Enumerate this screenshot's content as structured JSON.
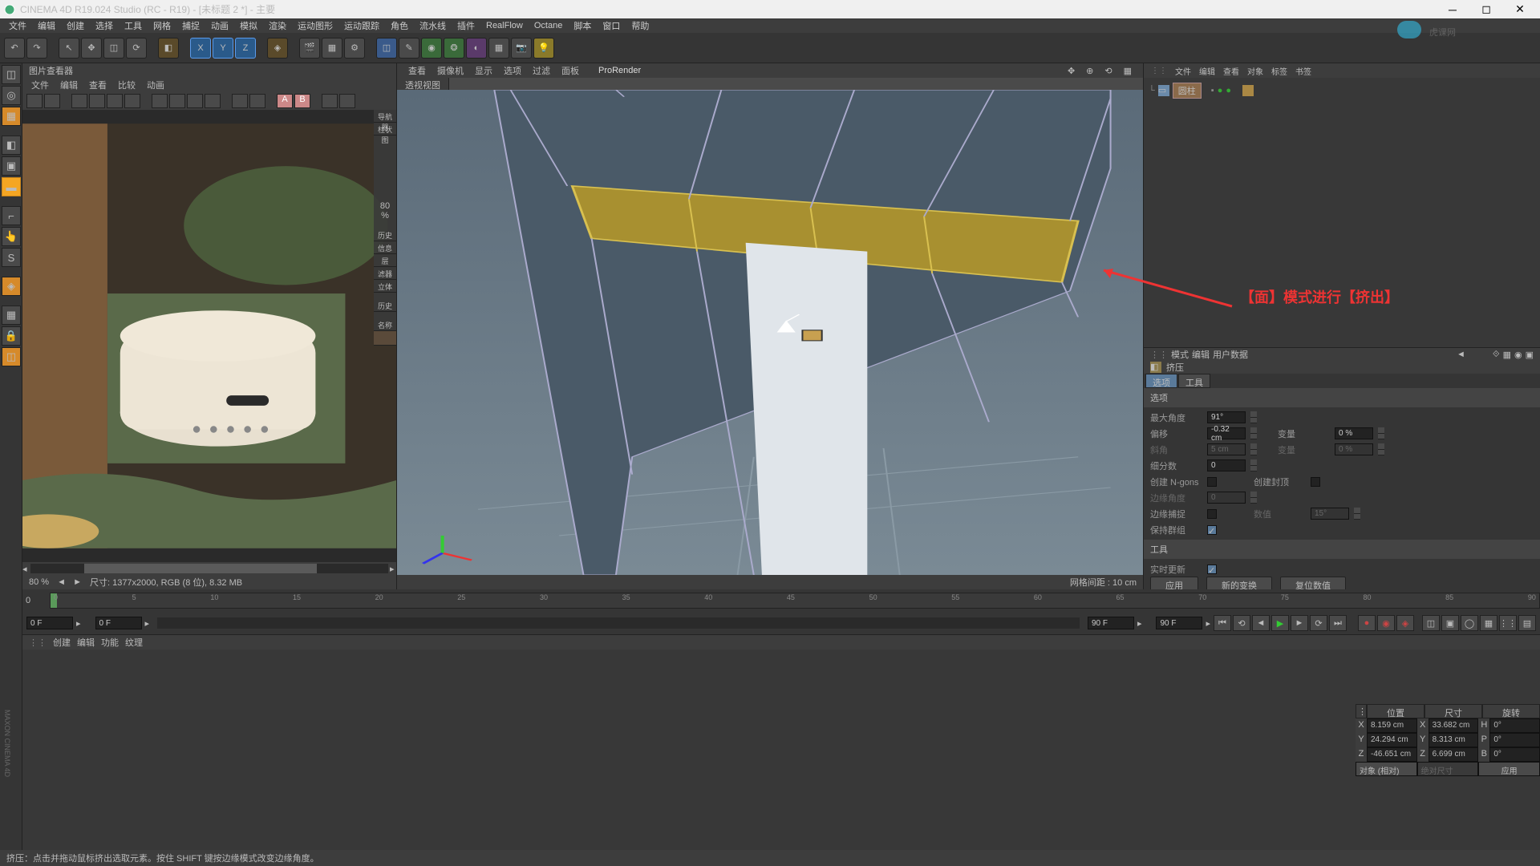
{
  "title": "CINEMA 4D R19.024 Studio (RC - R19) - [未标题 2 *] - 主要",
  "menu": [
    "文件",
    "编辑",
    "创建",
    "选择",
    "工具",
    "网格",
    "捕捉",
    "动画",
    "模拟",
    "渲染",
    "运动图形",
    "运动跟踪",
    "角色",
    "流水线",
    "插件",
    "RealFlow",
    "Octane",
    "脚本",
    "窗口",
    "帮助"
  ],
  "imgpanel": {
    "title": "图片查看器",
    "menu": [
      "文件",
      "编辑",
      "查看",
      "比较",
      "动画"
    ]
  },
  "imgstatus": {
    "zoom": "80 %",
    "info": "尺寸: 1377x2000, RGB (8 位), 8.32 MB"
  },
  "viewport": {
    "menu": [
      "查看",
      "摄像机",
      "显示",
      "选项",
      "过滤",
      "面板",
      "ProRender"
    ],
    "tab": "透视视图",
    "footer": "网格间距 : 10 cm",
    "zoom": "80 %"
  },
  "nav": {
    "nav": "导航器",
    "cyl": "柱状图",
    "hist": "历史",
    "info": "信息",
    "layer": "层",
    "filter": "滤器",
    "cube": "立体",
    "hist2": "历史",
    "name": "名称"
  },
  "objmgr": {
    "menu": [
      "文件",
      "编辑",
      "查看",
      "对象",
      "标签",
      "书签"
    ],
    "obj": "圆柱"
  },
  "attr": {
    "menu": [
      "模式",
      "编辑",
      "用户数据"
    ],
    "title": "挤压",
    "tabs": [
      "选项",
      "工具"
    ],
    "section": "选项",
    "rows": {
      "maxangle": "最大角度",
      "offset": "偏移",
      "bevel": "斜角",
      "subdiv": "细分数",
      "ngons": "创建 N-gons",
      "cap": "创建封顶",
      "edgeangle": "边缘角度",
      "edgesnap": "边缘捕捉",
      "count": "数值",
      "keepgroup": "保持群组",
      "var": "变量"
    },
    "vals": {
      "maxangle": "91°",
      "offset": "-0.32 cm",
      "bevel": "5 cm",
      "subdiv": "0",
      "var1": "0 %",
      "var2": "0 %",
      "edgeangle": "0",
      "count": "15°"
    },
    "section2": "工具",
    "realtime": "实时更新",
    "btns": {
      "apply": "应用",
      "newtrans": "新的变换",
      "reset": "复位数值"
    }
  },
  "timeline": {
    "start": "0",
    "ticks": [
      "0",
      "5",
      "10",
      "15",
      "20",
      "25",
      "30",
      "35",
      "40",
      "45",
      "50",
      "55",
      "60",
      "65",
      "70",
      "75",
      "80",
      "85",
      "90"
    ]
  },
  "playbar": {
    "f1": "0 F",
    "f2": "0 F",
    "f3": "90 F",
    "f4": "90 F"
  },
  "coords": {
    "headers": [
      "位置",
      "尺寸",
      "旋转"
    ],
    "x": {
      "p": "8.159 cm",
      "s": "33.682 cm",
      "r": "0°"
    },
    "y": {
      "p": "24.294 cm",
      "s": "8.313 cm",
      "r": "0°"
    },
    "z": {
      "p": "-46.651 cm",
      "s": "6.699 cm",
      "r": "0°"
    },
    "sel": "对象 (相对)",
    "scale": "绝对尺寸",
    "apply": "应用",
    "labels": {
      "x": "X",
      "y": "Y",
      "z": "Z",
      "h": "H",
      "p": "P",
      "b": "B"
    }
  },
  "matpanel": {
    "menu": [
      "创建",
      "编辑",
      "功能",
      "纹理"
    ]
  },
  "status": "挤压：点击并拖动鼠标挤出选取元素。按住 SHIFT 键按边缘模式改变边缘角度。",
  "annotation": "【面】模式进行【挤出】"
}
